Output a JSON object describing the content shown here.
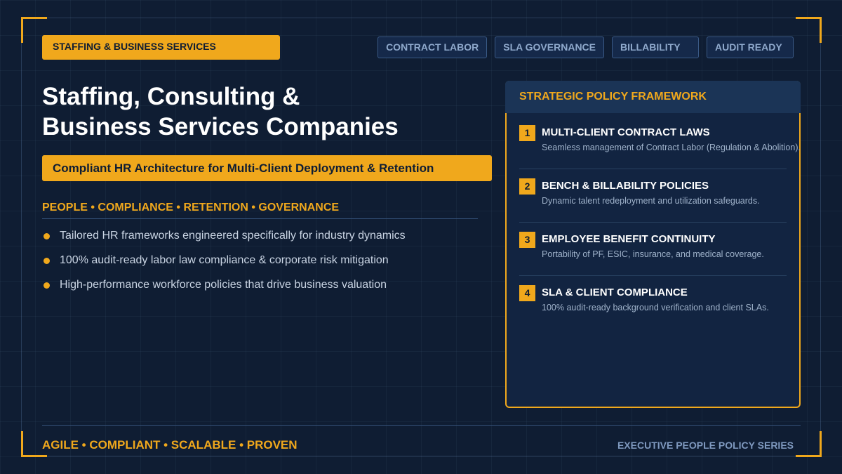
{
  "header": {
    "badge": "STAFFING & BUSINESS SERVICES",
    "tags": [
      "CONTRACT LABOR",
      "SLA GOVERNANCE",
      "BILLABILITY",
      "AUDIT READY"
    ]
  },
  "main": {
    "title_line1": "Staffing, Consulting &",
    "title_line2": "Business Services Companies",
    "subtitle": "Compliant HR Architecture for Multi-Client Deployment & Retention",
    "pillars": "PEOPLE • COMPLIANCE • RETENTION • GOVERNANCE",
    "bullets": [
      "Tailored HR frameworks engineered specifically for industry dynamics",
      "100% audit-ready labor law compliance & corporate risk mitigation",
      "High-performance workforce policies that drive business valuation"
    ]
  },
  "panel": {
    "heading": "STRATEGIC POLICY FRAMEWORK",
    "policies": [
      {
        "num": "1",
        "title": "MULTI-CLIENT CONTRACT LAWS",
        "desc": "Seamless management of Contract Labor (Regulation & Abolition)."
      },
      {
        "num": "2",
        "title": "BENCH & BILLABILITY POLICIES",
        "desc": "Dynamic talent redeployment and utilization safeguards."
      },
      {
        "num": "3",
        "title": "EMPLOYEE BENEFIT CONTINUITY",
        "desc": "Portability of PF, ESIC, insurance, and medical coverage."
      },
      {
        "num": "4",
        "title": "SLA & CLIENT COMPLIANCE",
        "desc": "100% audit-ready background verification and client SLAs."
      }
    ]
  },
  "footer": {
    "tagline": "AGILE • COMPLIANT • SCALABLE • PROVEN",
    "series": "EXECUTIVE PEOPLE POLICY SERIES"
  },
  "colors": {
    "background": "#0f1d33",
    "accent": "#f0a81c",
    "panel": "#122441"
  }
}
